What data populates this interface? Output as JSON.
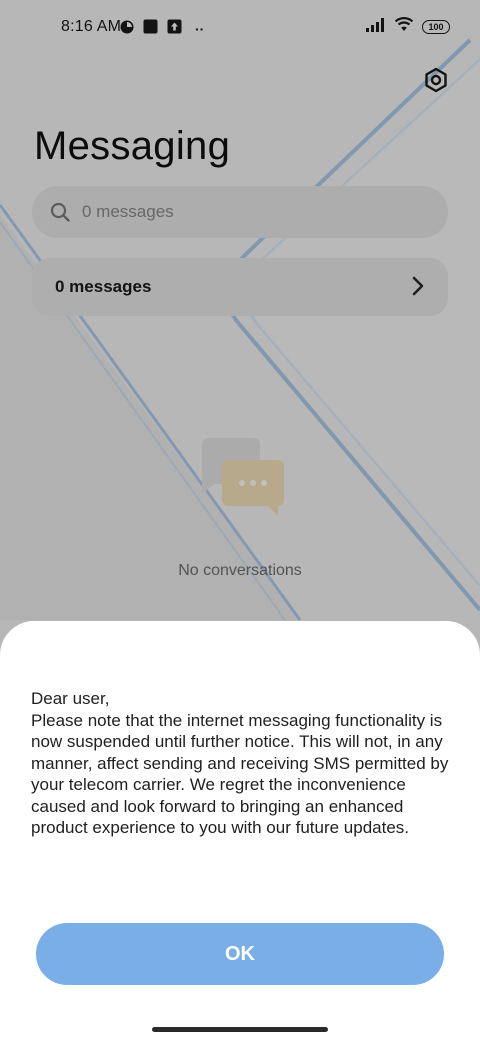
{
  "status_bar": {
    "time": "8:16 AM",
    "left_icons": [
      "app-status-icon",
      "square-notification-icon",
      "upload-notification-icon",
      "more-notifications-icon"
    ],
    "more_label": "··",
    "battery_level": "100",
    "right_icons": [
      "signal-icon",
      "wifi-icon",
      "battery-icon"
    ]
  },
  "header": {
    "title": "Messaging",
    "settings_icon": "settings-icon"
  },
  "search": {
    "placeholder": "0 messages",
    "icon": "search-icon"
  },
  "summary_row": {
    "label": "0 messages",
    "icon": "chevron-right-icon"
  },
  "empty_state": {
    "text": "No conversations",
    "icon": "chat-bubbles-icon"
  },
  "dialog": {
    "message": "Dear user,\nPlease note that the internet messaging functionality is now suspended until further notice. This will not, in any manner, affect sending and receiving SMS permitted by your telecom carrier. We regret the inconvenience caused and look forward to bringing an enhanced product experience to you with our future updates.",
    "ok_label": "OK"
  },
  "colors": {
    "accent_button": "#7aaee6",
    "background": "#f4f4f4",
    "deco_stroke": "#7fb3e6"
  }
}
